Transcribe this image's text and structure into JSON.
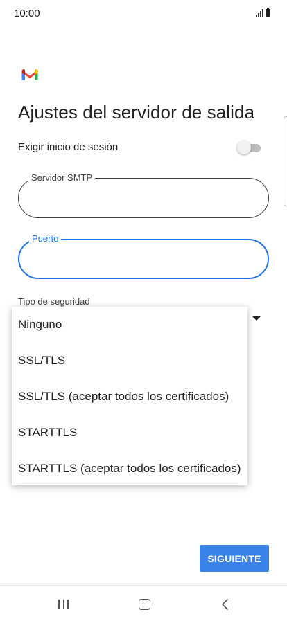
{
  "status_bar": {
    "time": "10:00",
    "icons": [
      "signal-icon",
      "battery-icon"
    ]
  },
  "app": {
    "logo_icon": "gmail-logo-icon",
    "title": "Ajustes del servidor de salida"
  },
  "login": {
    "label": "Exigir inicio de sesión",
    "enabled": false
  },
  "smtp_field": {
    "label": "Servidor SMTP",
    "value": ""
  },
  "port_field": {
    "label": "Puerto",
    "value": "",
    "focused": true
  },
  "security": {
    "label": "Tipo de seguridad",
    "options": [
      "Ninguno",
      "SSL/TLS",
      "SSL/TLS (aceptar todos los certificados)",
      "STARTTLS",
      "STARTTLS (aceptar todos los certificados)"
    ]
  },
  "next_button": {
    "label": "SIGUIENTE"
  },
  "nav_bar": {
    "icons": [
      "recents-icon",
      "home-icon",
      "back-icon"
    ]
  },
  "colors": {
    "accent": "#1a73e8",
    "button": "#3b82e8",
    "text": "#202124"
  }
}
